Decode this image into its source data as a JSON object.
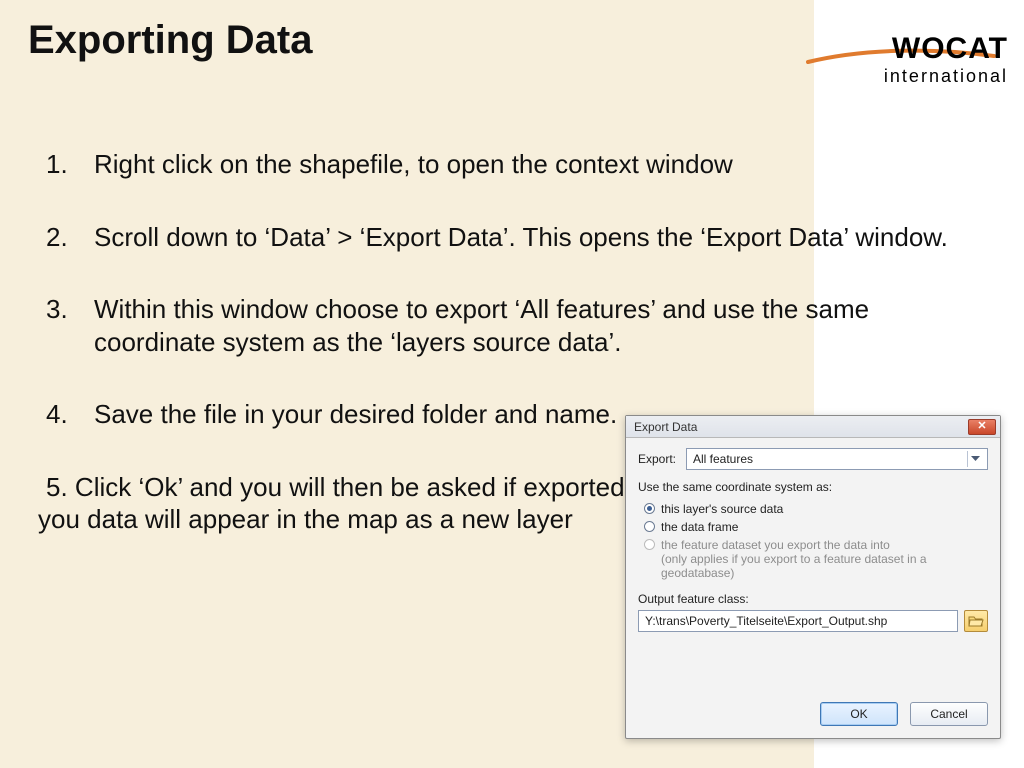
{
  "title": "Exporting Data",
  "logo": {
    "top": "WOCAT",
    "sub": "international"
  },
  "steps": {
    "s1": {
      "num": "1.",
      "text": "Right click on the shapefile, to open the context window"
    },
    "s2": {
      "num": "2.",
      "text": "Scroll down to ‘Data’ > ‘Export Data’. This opens the ‘Export Data’ window."
    },
    "s3": {
      "num": "3.",
      "text": "Within this window choose to export ‘All features’ and use the same coordinate system as the ‘layers source data’."
    },
    "s4": {
      "num": "4.",
      "text": "Save the file in your desired folder and name."
    },
    "s5": {
      "num": "5.",
      "text": "   Click ‘Ok’ and you will then be asked if exported data to the map as a layer. If you data will appear in the map as a new layer"
    }
  },
  "dialog": {
    "title": "Export Data",
    "close_glyph": "✕",
    "export_label": "Export:",
    "export_value": "All features",
    "coord_prompt": "Use the same coordinate system as:",
    "radios": {
      "r1": "this layer's source data",
      "r2": "the data frame",
      "r3a": "the feature dataset you export the data into",
      "r3b": "(only applies if you export to a feature dataset in a geodatabase)"
    },
    "output_label": "Output feature class:",
    "output_value": "Y:\\trans\\Poverty_Titelseite\\Export_Output.shp",
    "ok_label": "OK",
    "cancel_label": "Cancel"
  }
}
